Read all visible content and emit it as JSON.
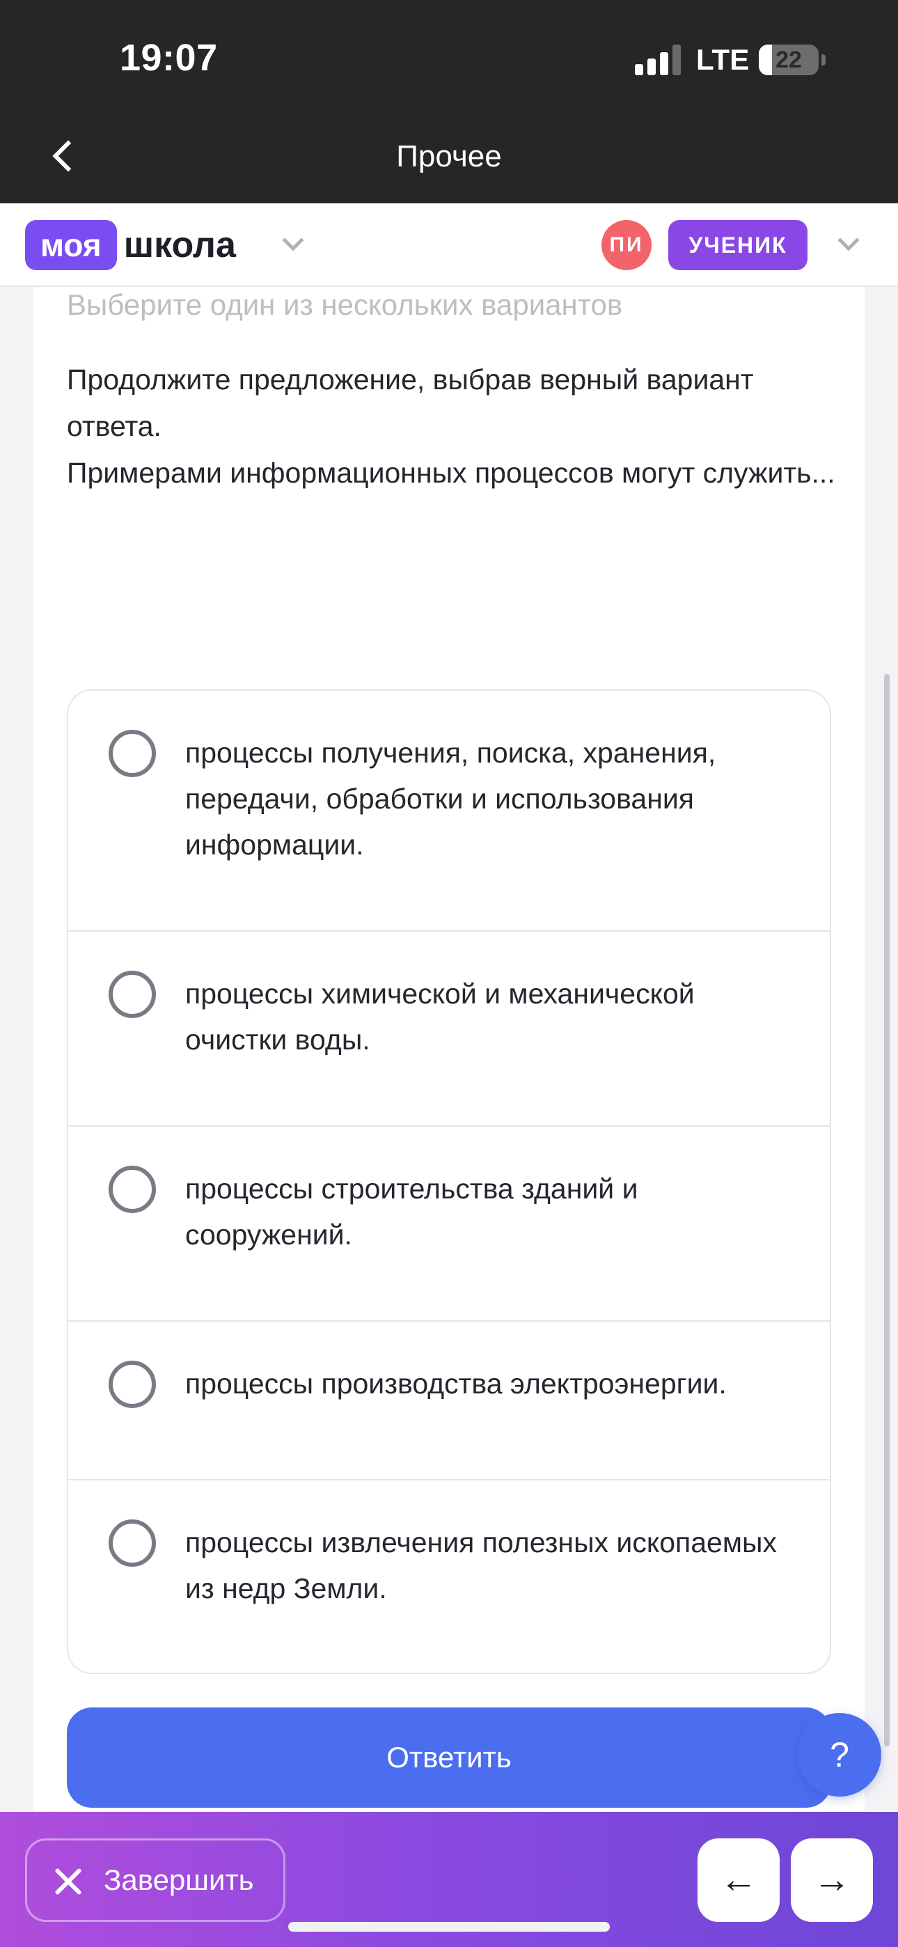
{
  "status_bar": {
    "time": "19:07",
    "network": "LTE",
    "battery": "22",
    "battery_level": 0.22
  },
  "nav": {
    "title": "Прочее"
  },
  "header": {
    "logo_highlight": "моя",
    "logo_text": "школа",
    "avatar_initials": "ПИ",
    "role": "УЧЕНИК"
  },
  "task": {
    "instruction": "Выберите один из нескольких вариантов",
    "question_line1": "Продолжите предложение, выбрав верный вариант ответа.",
    "question_line2": "Примерами информационных процессов могут служить..."
  },
  "options": [
    {
      "label": "процессы получения, поиска, хранения, передачи, обработки и использования информации.",
      "selected": false
    },
    {
      "label": "процессы химической и механической очистки воды.",
      "selected": false
    },
    {
      "label": "процессы строительства зданий и сооружений.",
      "selected": false
    },
    {
      "label": "процессы производства электроэнергии.",
      "selected": false
    },
    {
      "label": "процессы извлечения полезных ископаемых из недр Земли.",
      "selected": false
    }
  ],
  "actions": {
    "submit": "Ответить",
    "help": "?",
    "finish": "Завершить",
    "prev": "←",
    "next": "→"
  },
  "colors": {
    "brand_purple": "#7a4df0",
    "submit_blue": "#4b6ef0",
    "avatar_red": "#f2636a",
    "role_purple": "#8a47e6"
  },
  "icons": {
    "back": "chevron-left-icon",
    "logo_menu": "chevron-down-icon",
    "profile_menu": "chevron-down-icon",
    "finish": "close-icon"
  }
}
